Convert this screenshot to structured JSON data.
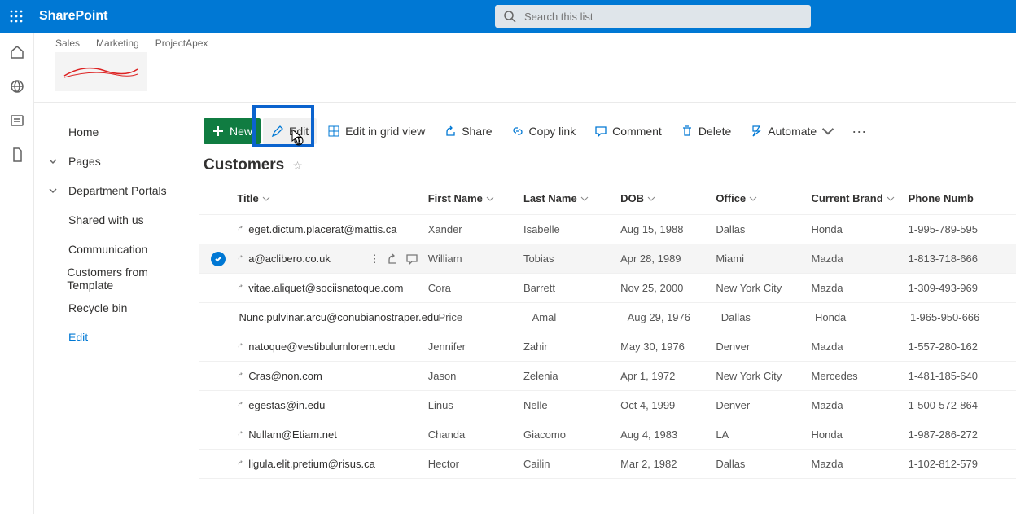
{
  "suite": {
    "title": "SharePoint"
  },
  "search": {
    "placeholder": "Search this list"
  },
  "crumbs": [
    "Sales",
    "Marketing",
    "ProjectApex"
  ],
  "leftnav": {
    "home": "Home",
    "pages": "Pages",
    "department": "Department Portals",
    "shared": "Shared with us",
    "communication": "Communication",
    "customers_template": "Customers from Template",
    "recycle": "Recycle bin",
    "edit": "Edit"
  },
  "cmd": {
    "new": "New",
    "edit": "Edit",
    "gridview": "Edit in grid view",
    "share": "Share",
    "copylink": "Copy link",
    "comment": "Comment",
    "delete": "Delete",
    "automate": "Automate"
  },
  "list": {
    "title": "Customers"
  },
  "columns": {
    "title": "Title",
    "first_name": "First Name",
    "last_name": "Last Name",
    "dob": "DOB",
    "office": "Office",
    "brand": "Current Brand",
    "phone": "Phone Numb"
  },
  "rows": [
    {
      "title": "eget.dictum.placerat@mattis.ca",
      "first": "Xander",
      "last": "Isabelle",
      "dob": "Aug 15, 1988",
      "office": "Dallas",
      "brand": "Honda",
      "phone": "1-995-789-595"
    },
    {
      "title": "a@aclibero.co.uk",
      "first": "William",
      "last": "Tobias",
      "dob": "Apr 28, 1989",
      "office": "Miami",
      "brand": "Mazda",
      "phone": "1-813-718-666",
      "selected": true
    },
    {
      "title": "vitae.aliquet@sociisnatoque.com",
      "first": "Cora",
      "last": "Barrett",
      "dob": "Nov 25, 2000",
      "office": "New York City",
      "brand": "Mazda",
      "phone": "1-309-493-969"
    },
    {
      "title": "Nunc.pulvinar.arcu@conubianostraper.edu",
      "first": "Price",
      "last": "Amal",
      "dob": "Aug 29, 1976",
      "office": "Dallas",
      "brand": "Honda",
      "phone": "1-965-950-666"
    },
    {
      "title": "natoque@vestibulumlorem.edu",
      "first": "Jennifer",
      "last": "Zahir",
      "dob": "May 30, 1976",
      "office": "Denver",
      "brand": "Mazda",
      "phone": "1-557-280-162"
    },
    {
      "title": "Cras@non.com",
      "first": "Jason",
      "last": "Zelenia",
      "dob": "Apr 1, 1972",
      "office": "New York City",
      "brand": "Mercedes",
      "phone": "1-481-185-640"
    },
    {
      "title": "egestas@in.edu",
      "first": "Linus",
      "last": "Nelle",
      "dob": "Oct 4, 1999",
      "office": "Denver",
      "brand": "Mazda",
      "phone": "1-500-572-864"
    },
    {
      "title": "Nullam@Etiam.net",
      "first": "Chanda",
      "last": "Giacomo",
      "dob": "Aug 4, 1983",
      "office": "LA",
      "brand": "Honda",
      "phone": "1-987-286-272"
    },
    {
      "title": "ligula.elit.pretium@risus.ca",
      "first": "Hector",
      "last": "Cailin",
      "dob": "Mar 2, 1982",
      "office": "Dallas",
      "brand": "Mazda",
      "phone": "1-102-812-579"
    }
  ]
}
